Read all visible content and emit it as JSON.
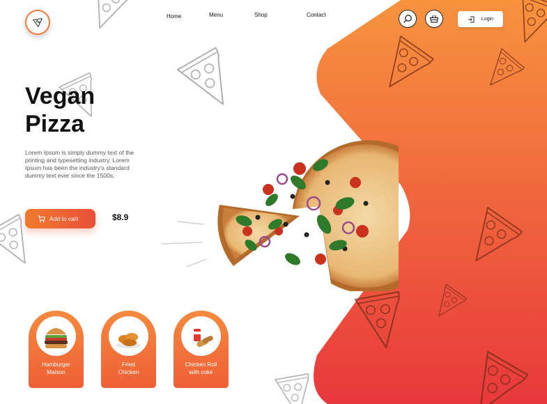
{
  "nav": {
    "links": [
      "Home",
      "Menu",
      "Shop",
      "Contact"
    ],
    "login_label": "Login"
  },
  "hero": {
    "title_line1": "Vegan",
    "title_line2": "Pizza",
    "description": "Lorem Ipsum is simply dummy text of the printing and typesetting industry. Lorem Ipsum has been the industry's standard dummy text ever since the 1500s,",
    "cart_label": "Add to cart",
    "price": "$8.9"
  },
  "categories": [
    {
      "label": "Hamburger\nMaison",
      "icon": "burger-icon"
    },
    {
      "label": "Fried\nChicken",
      "icon": "fried-chicken-icon"
    },
    {
      "label": "Chicken Roll\nwith coke",
      "icon": "chicken-roll-icon"
    }
  ],
  "colors": {
    "accent_top": "#f7933f",
    "accent_bottom": "#e8383c",
    "text": "#111111",
    "muted": "#55585e"
  }
}
